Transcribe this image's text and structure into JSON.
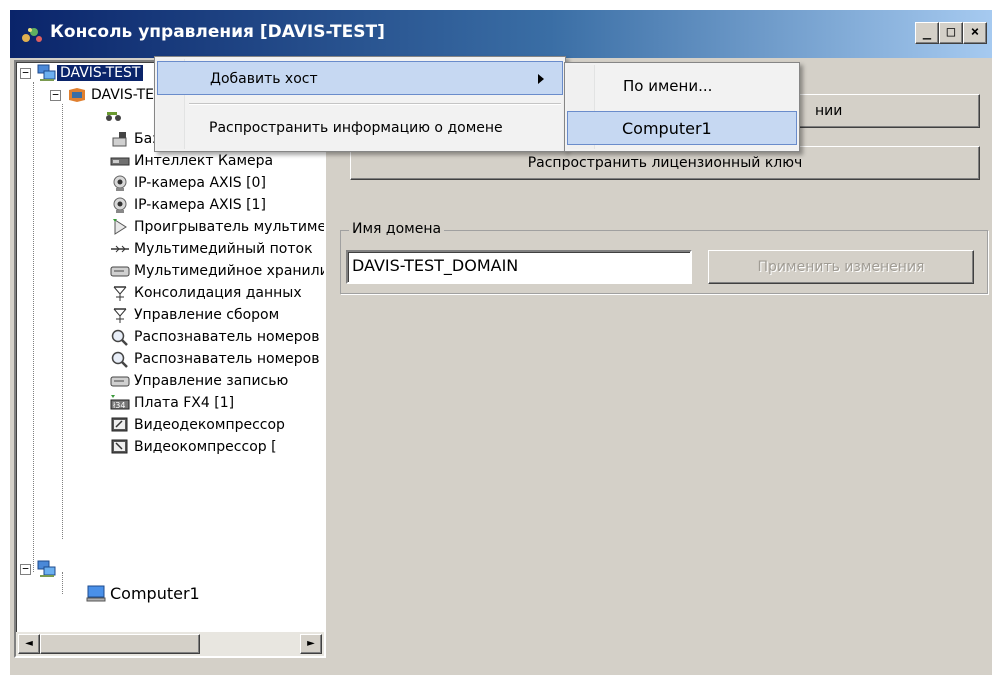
{
  "window": {
    "title": "Консоль управления [DAVIS-TEST]",
    "controls": [
      "_",
      "□",
      "×"
    ]
  },
  "tree": {
    "items": [
      {
        "label": "DAVIS-TEST",
        "icon": "computer-network-icon"
      },
      {
        "label": "DAVIS-TEST",
        "icon": "server-icon"
      },
      {
        "label": "",
        "icon": "camera-switch-icon"
      },
      {
        "label": "Базовые детекторы",
        "icon": "detector-icon"
      },
      {
        "label": "Интеллект Камера",
        "icon": "camera-board-icon"
      },
      {
        "label": "IP-камера AXIS [0]",
        "icon": "ip-camera-icon"
      },
      {
        "label": "IP-камера AXIS [1]",
        "icon": "ip-camera-icon"
      },
      {
        "label": "Проигрыватель мультимедиа",
        "icon": "player-icon"
      },
      {
        "label": "Мультимедийный поток",
        "icon": "stream-icon"
      },
      {
        "label": "Мультимедийное хранилище",
        "icon": "storage-icon"
      },
      {
        "label": "Консолидация данных",
        "icon": "consolidation-icon"
      },
      {
        "label": "Управление сбором",
        "icon": "collection-icon"
      },
      {
        "label": "Распознаватель номеров",
        "icon": "recognizer-icon"
      },
      {
        "label": "Распознаватель номеров",
        "icon": "recognizer-icon"
      },
      {
        "label": "Управление записью",
        "icon": "record-icon"
      },
      {
        "label": "Плата FX4 [1]",
        "icon": "board-icon"
      },
      {
        "label": "Видеодекомпрессор",
        "icon": "decompressor-icon"
      },
      {
        "label": "Видеокомпрессор [",
        "icon": "compressor-icon"
      },
      {
        "label": "",
        "icon": "computer-network-icon"
      },
      {
        "label": "Computer1",
        "icon": "computer-icon"
      }
    ],
    "scroll_left": "◄",
    "scroll_right": "►"
  },
  "right_panel": {
    "button_partial": "нии",
    "button_license": "Распространить лицензионный ключ",
    "domain_group": "Имя домена",
    "domain_value": "DAVIS-TEST_DOMAIN",
    "apply_button": "Применить изменения"
  },
  "context_menu": {
    "items": [
      {
        "label": "Добавить хост"
      },
      {
        "label": "Распространить информацию о домене"
      }
    ]
  },
  "submenu": {
    "items": [
      {
        "label": "По имени..."
      },
      {
        "label": "Computer1"
      }
    ]
  }
}
